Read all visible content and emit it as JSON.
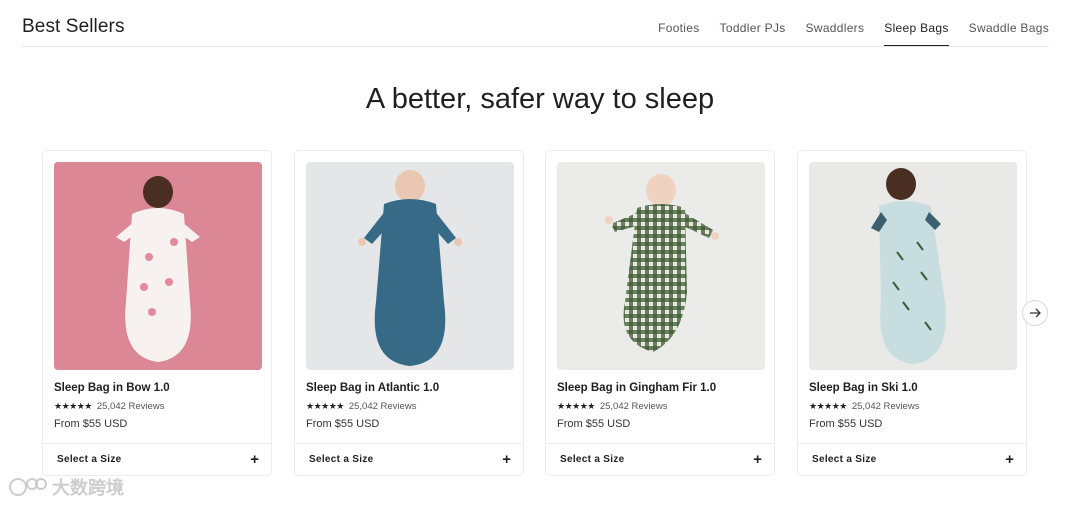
{
  "header": {
    "title": "Best Sellers",
    "tabs": [
      {
        "label": "Footies"
      },
      {
        "label": "Toddler PJs"
      },
      {
        "label": "Swaddlers"
      },
      {
        "label": "Sleep Bags",
        "active": true
      },
      {
        "label": "Swaddle Bags"
      }
    ]
  },
  "headline": "A better, safer way to sleep",
  "products": [
    {
      "title": "Sleep Bag in Bow 1.0",
      "stars": "★★★★★",
      "reviews": "25,042 Reviews",
      "price": "From $55 USD",
      "size_label": "Select a Size",
      "plus": "+",
      "bg_color": "#dc8795",
      "garment_color": "#f7f2ef"
    },
    {
      "title": "Sleep Bag in Atlantic 1.0",
      "stars": "★★★★★",
      "reviews": "25,042 Reviews",
      "price": "From $55 USD",
      "size_label": "Select a Size",
      "plus": "+",
      "bg_color": "#e4e6e8",
      "garment_color": "#376a86"
    },
    {
      "title": "Sleep Bag in Gingham Fir 1.0",
      "stars": "★★★★★",
      "reviews": "25,042 Reviews",
      "price": "From $55 USD",
      "size_label": "Select a Size",
      "plus": "+",
      "bg_color": "#ebebea",
      "garment_color": "#3d5a34"
    },
    {
      "title": "Sleep Bag in Ski 1.0",
      "stars": "★★★★★",
      "reviews": "25,042 Reviews",
      "price": "From $55 USD",
      "size_label": "Select a Size",
      "plus": "+",
      "bg_color": "#e9e9e8",
      "garment_color": "#c8dde0"
    }
  ],
  "next_icon": "arrow-right-icon",
  "watermark": "大数跨境"
}
